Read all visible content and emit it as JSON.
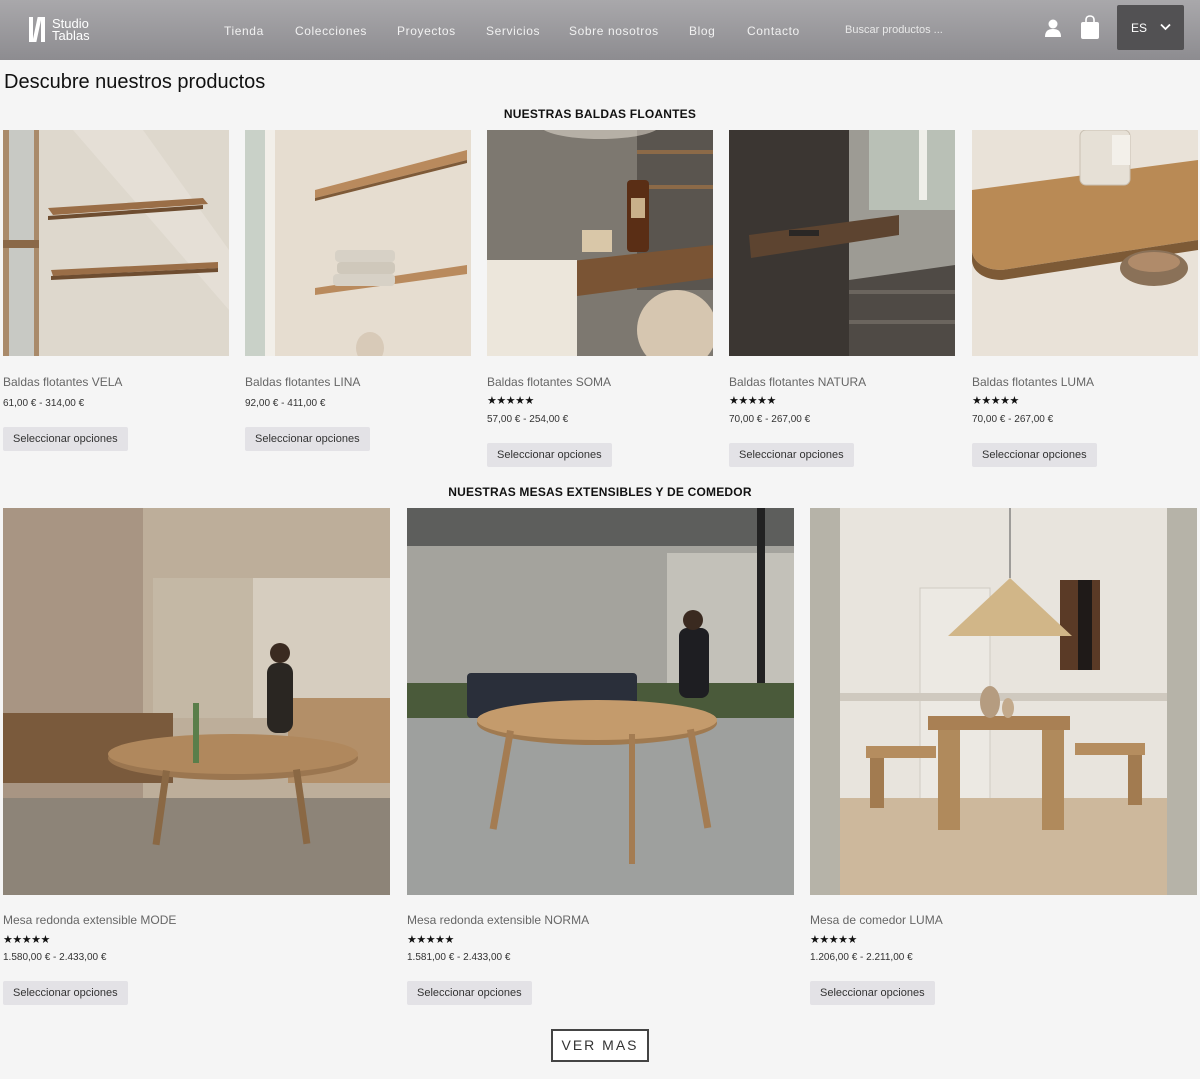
{
  "header": {
    "logo_line1": "Studio",
    "logo_line2": "Tablas",
    "nav": [
      "Tienda",
      "Colecciones",
      "Proyectos",
      "Servicios",
      "Sobre nosotros",
      "Blog",
      "Contacto"
    ],
    "search_placeholder": "Buscar productos ...",
    "lang": "ES",
    "icons": [
      "user-icon",
      "shopping-bag-icon",
      "chevron-down-icon"
    ]
  },
  "page_title": "Descubre nuestros productos",
  "shelves": {
    "title": "NUESTRAS BALDAS FLOANTES",
    "products": [
      {
        "name": "Baldas flotantes VELA",
        "stars": "",
        "price": "61,00 € - 314,00 €",
        "button": "Seleccionar opciones"
      },
      {
        "name": "Baldas flotantes LINA",
        "stars": "",
        "price": "92,00 € - 411,00 €",
        "button": "Seleccionar opciones"
      },
      {
        "name": "Baldas flotantes SOMA",
        "stars": "★★★★★",
        "price": "57,00 € - 254,00 €",
        "button": "Seleccionar opciones"
      },
      {
        "name": "Baldas flotantes NATURA",
        "stars": "★★★★★",
        "price": "70,00 € - 267,00 €",
        "button": "Seleccionar opciones"
      },
      {
        "name": "Baldas flotantes LUMA",
        "stars": "★★★★★",
        "price": "70,00 € - 267,00 €",
        "button": "Seleccionar opciones"
      }
    ]
  },
  "tables": {
    "title": "NUESTRAS MESAS EXTENSIBLES Y DE COMEDOR",
    "products": [
      {
        "name": "Mesa redonda extensible MODE",
        "stars": "★★★★★",
        "price": "1.580,00 € - 2.433,00 €",
        "button": "Seleccionar opciones"
      },
      {
        "name": "Mesa redonda extensible NORMA",
        "stars": "★★★★★",
        "price": "1.581,00 € - 2.433,00 €",
        "button": "Seleccionar opciones"
      },
      {
        "name": "Mesa de comedor LUMA",
        "stars": "★★★★★",
        "price": "1.206,00 € - 2.211,00 €",
        "button": "Seleccionar opciones"
      }
    ]
  },
  "more_button": "VER MAS"
}
